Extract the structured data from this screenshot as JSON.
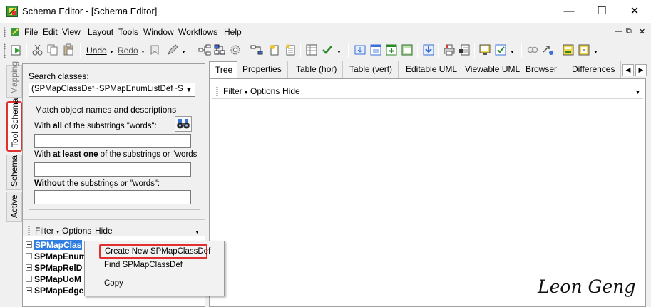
{
  "window": {
    "title": "Schema Editor - [Schema Editor]",
    "minimize_glyph": "—",
    "maximize_glyph": "☐",
    "close_glyph": "✕"
  },
  "menu": {
    "items": [
      "File",
      "Edit",
      "View",
      "Layout",
      "Tools",
      "Window",
      "Workflows",
      "Help"
    ],
    "mdi_controls": [
      "—",
      "⧉",
      "✕"
    ]
  },
  "toolbar": {
    "undo_label": "Undo",
    "redo_label": "Redo"
  },
  "side_tabs": {
    "mapping": "Mapping",
    "tool_schema": "Tool Schema",
    "schema": "Schema",
    "active": "Active"
  },
  "left_panel": {
    "search_classes_label": "Search classes:",
    "search_classes_value": "(SPMapClassDef~SPMapEnumListDef~SPMa",
    "match_group_title": "Match object names and descriptions",
    "criteria": {
      "all_prefix": "With ",
      "all_bold": "all",
      "all_suffix": " of the substrings \"words\":",
      "atleast_prefix": "With ",
      "atleast_bold": "at least one",
      "atleast_suffix": "  of the substrings or \"words",
      "without_bold": "Without",
      "without_suffix": "  the substrings or \"words\":"
    },
    "tree_toolbar": {
      "filter": "Filter",
      "options": "Options",
      "hide": "Hide"
    },
    "tree_items": [
      "SPMapClas",
      "SPMapEnum",
      "SPMapRelD",
      "SPMapUoM",
      "SPMapEdge"
    ]
  },
  "right_panel": {
    "tabs": [
      "Tree",
      "Properties",
      "Table (hor)",
      "Table (vert)",
      "Editable UML",
      "Viewable UML",
      "Browser",
      "Differences"
    ],
    "active_tab": "Tree",
    "filterbar": {
      "filter": "Filter",
      "options": "Options",
      "hide": "Hide"
    }
  },
  "context_menu": {
    "items": [
      "Create New SPMapClassDef",
      "Find SPMapClassDef",
      "Copy"
    ]
  },
  "watermark": "Leon Geng",
  "colors": {
    "highlight": "#e03030",
    "selection": "#2f7de1"
  }
}
